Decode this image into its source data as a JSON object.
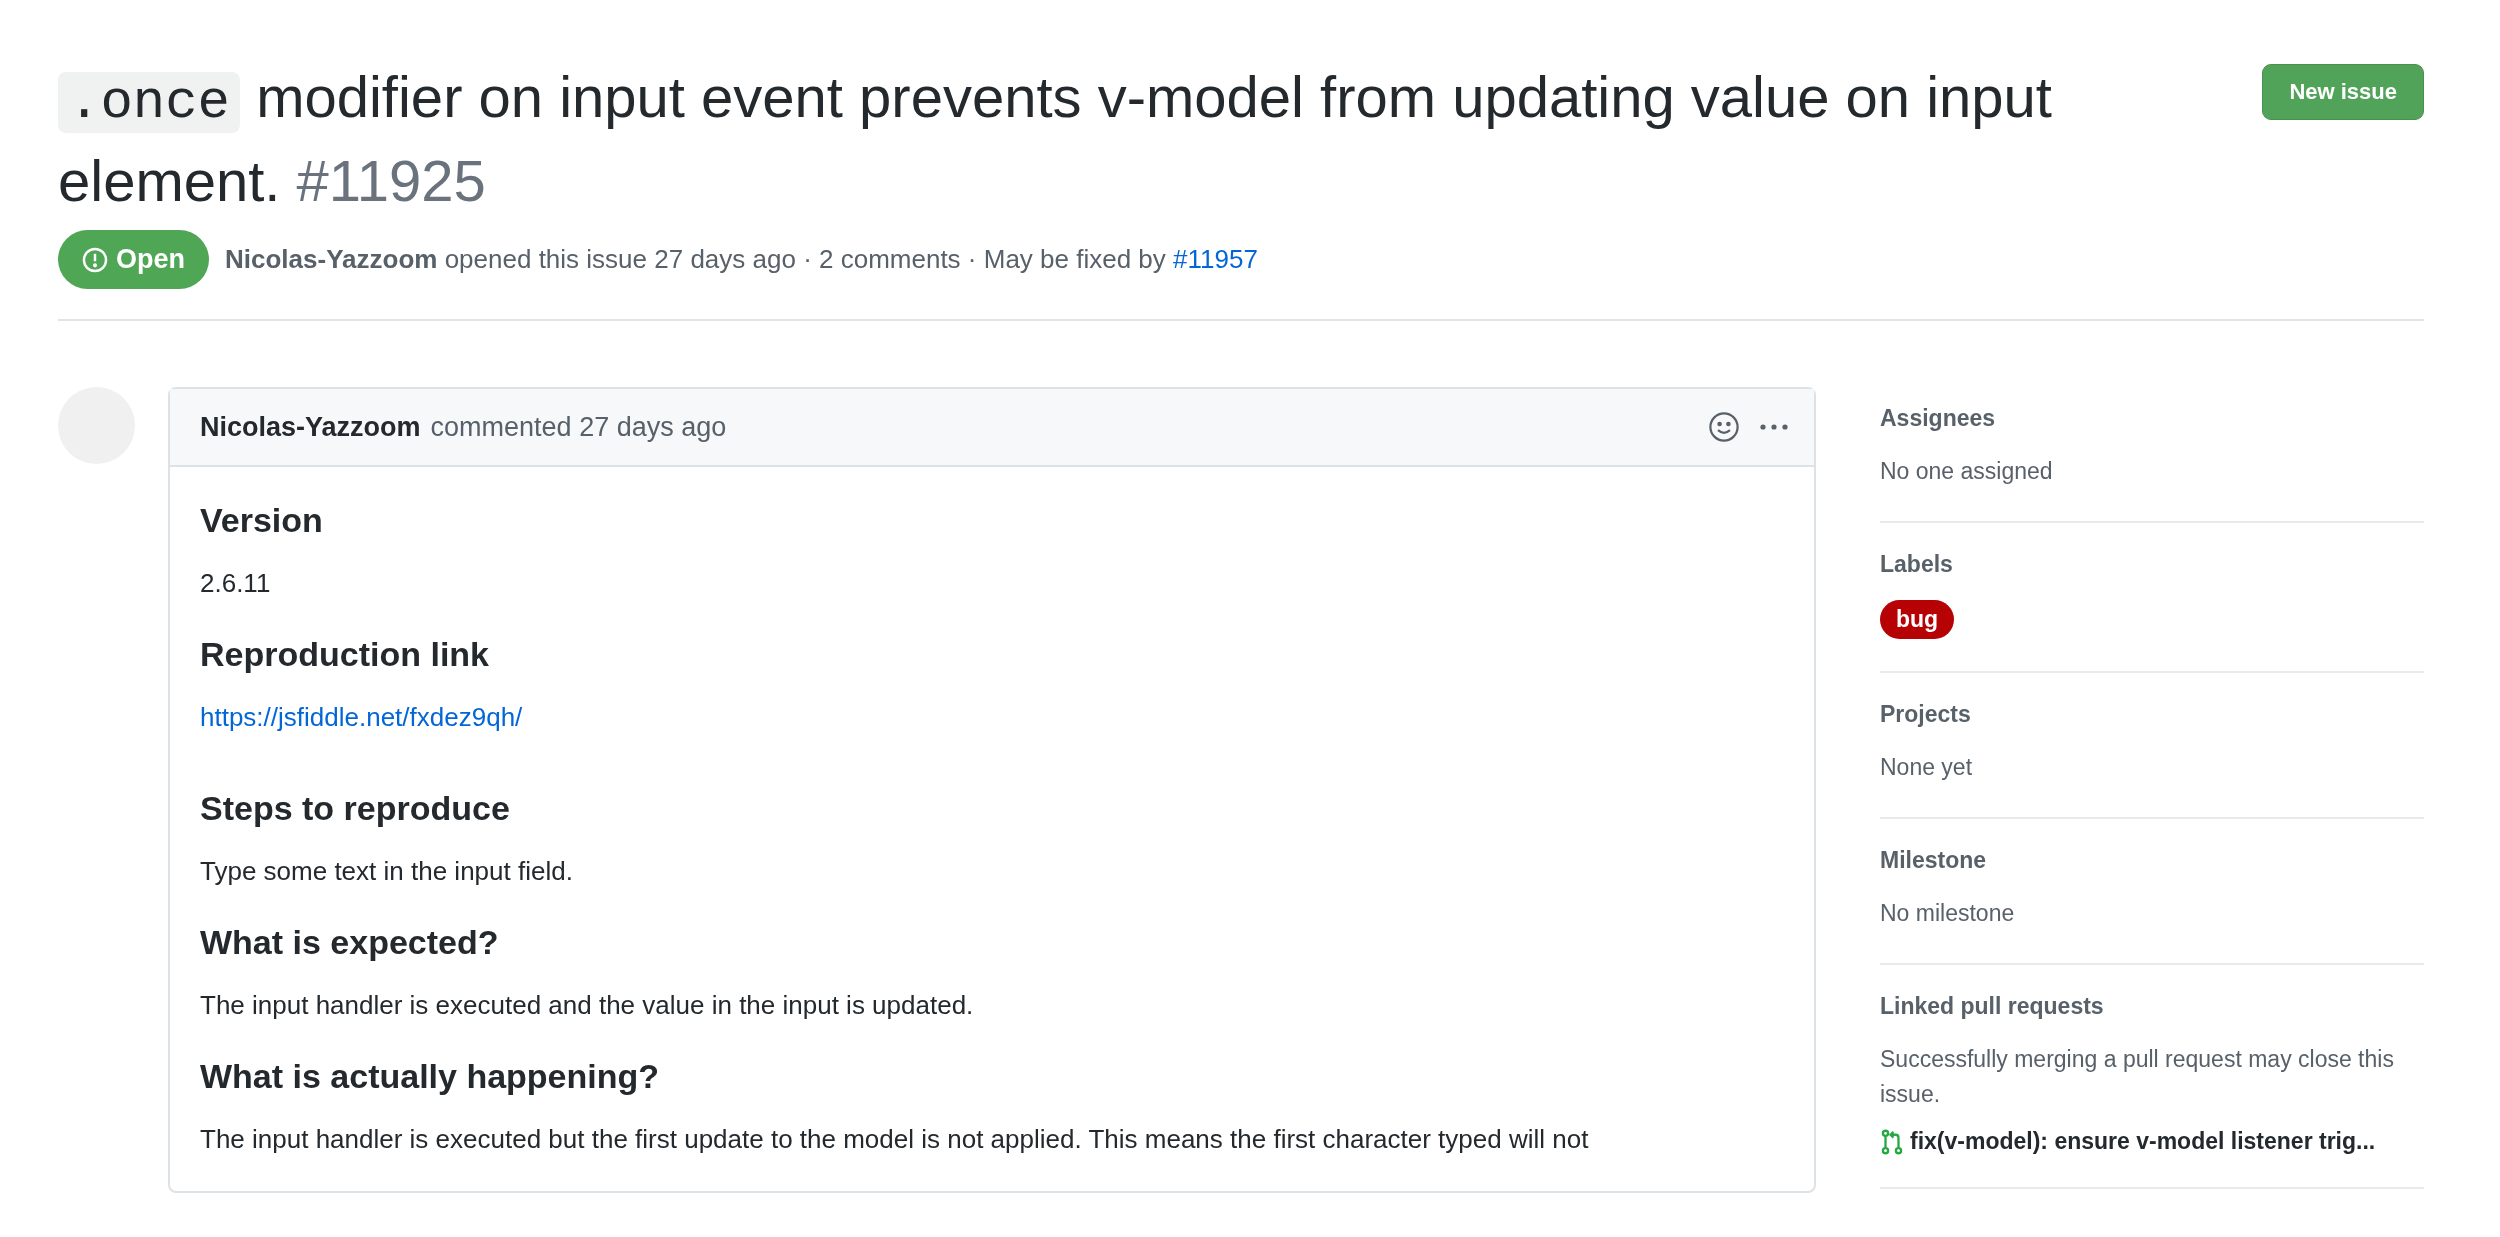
{
  "issue": {
    "title_code": ".once",
    "title": "modifier on input event prevents v-model from updating value on input element.",
    "number": "#11925",
    "new_issue_button": "New issue",
    "state": {
      "label": "Open",
      "kind": "open"
    },
    "meta": {
      "author": "Nicolas-Yazzoom",
      "text": "opened this issue 27 days ago · 2 comments · May be fixed by",
      "link": "#11957"
    }
  },
  "comment": {
    "author": "Nicolas-Yazzoom",
    "time": "commented 27 days ago",
    "body": [
      {
        "kind": "heading",
        "text": "Version"
      },
      {
        "kind": "paragraph",
        "text": "2.6.11"
      },
      {
        "kind": "heading",
        "text": "Reproduction link"
      },
      {
        "kind": "link",
        "text": "https://jsfiddle.net/fxdez9qh/"
      },
      {
        "kind": "heading",
        "text": "Steps to reproduce"
      },
      {
        "kind": "paragraph",
        "text": "Type some text in the input field."
      },
      {
        "kind": "heading",
        "text": "What is expected?"
      },
      {
        "kind": "paragraph",
        "text": "The input handler is executed and the value in the input is updated."
      },
      {
        "kind": "heading",
        "text": "What is actually happening?"
      },
      {
        "kind": "paragraph",
        "text": "The input handler is executed but the first update to the model is not applied. This means the first character typed will not"
      }
    ]
  },
  "sidebar": [
    {
      "kind": "text",
      "heading": "Assignees",
      "value": "No one assigned"
    },
    {
      "kind": "labels",
      "heading": "Labels",
      "labels": [
        {
          "name": "bug",
          "color": "#b60205"
        }
      ]
    },
    {
      "kind": "text",
      "heading": "Projects",
      "value": "None yet"
    },
    {
      "kind": "text",
      "heading": "Milestone",
      "value": "No milestone"
    },
    {
      "kind": "pulls",
      "heading": "Linked pull requests",
      "value": "Successfully merging a pull request may close this issue.",
      "pull": "fix(v-model): ensure v-model listener trig..."
    }
  ]
}
